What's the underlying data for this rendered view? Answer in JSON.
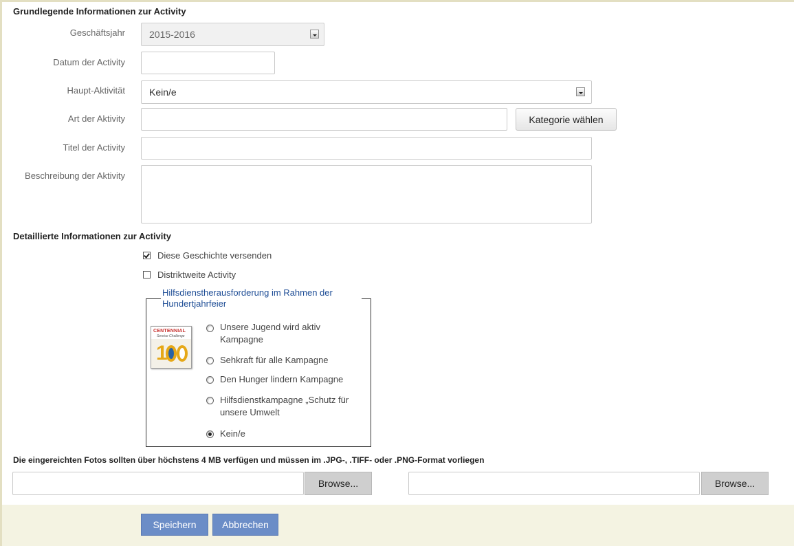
{
  "basic": {
    "title": "Grundlegende Informationen zur Activity",
    "fiscal_year": {
      "label": "Geschäftsjahr",
      "value": "2015-2016"
    },
    "date": {
      "label": "Datum der Activity",
      "value": ""
    },
    "main_activity": {
      "label": "Haupt-Aktivität",
      "value": "Kein/e"
    },
    "activity_type": {
      "label": "Art der Aktivity",
      "value": "",
      "button": "Kategorie wählen"
    },
    "activity_title": {
      "label": "Titel der Activity",
      "value": ""
    },
    "description": {
      "label": "Beschreibung der Aktivity",
      "value": ""
    }
  },
  "detail": {
    "title": "Detaillierte Informationen zur Activity",
    "send_story": {
      "label": "Diese Geschichte versenden",
      "checked": true
    },
    "district_wide": {
      "label": "Distriktweite Activity",
      "checked": false
    },
    "centennial": {
      "legend": "Hilfsdienstherausforderung im Rahmen der Hundertjahrfeier",
      "logo": {
        "line1": "CENTENNIAL",
        "line2": "Service Challenge",
        "number": "1"
      },
      "options": [
        {
          "label": "Unsere Jugend wird aktiv Kampagne",
          "checked": false
        },
        {
          "label": "Sehkraft für alle Kampagne",
          "checked": false
        },
        {
          "label": "Den Hunger lindern Kampagne",
          "checked": false
        },
        {
          "label": "Hilfsdienstkampagne „Schutz für unsere Umwelt",
          "checked": false
        },
        {
          "label": "Kein/e",
          "checked": true
        }
      ]
    }
  },
  "photos": {
    "note": "Die eingereichten Fotos sollten über höchstens 4 MB verfügen und müssen im .JPG-, .TIFF- oder .PNG-Format vorliegen",
    "browse_label": "Browse..."
  },
  "actions": {
    "save": "Speichern",
    "cancel": "Abbrechen"
  },
  "colors": {
    "footer_bg": "#f4f3e2",
    "primary_button": "#6b8dc7",
    "legend_text": "#1f4e96"
  }
}
